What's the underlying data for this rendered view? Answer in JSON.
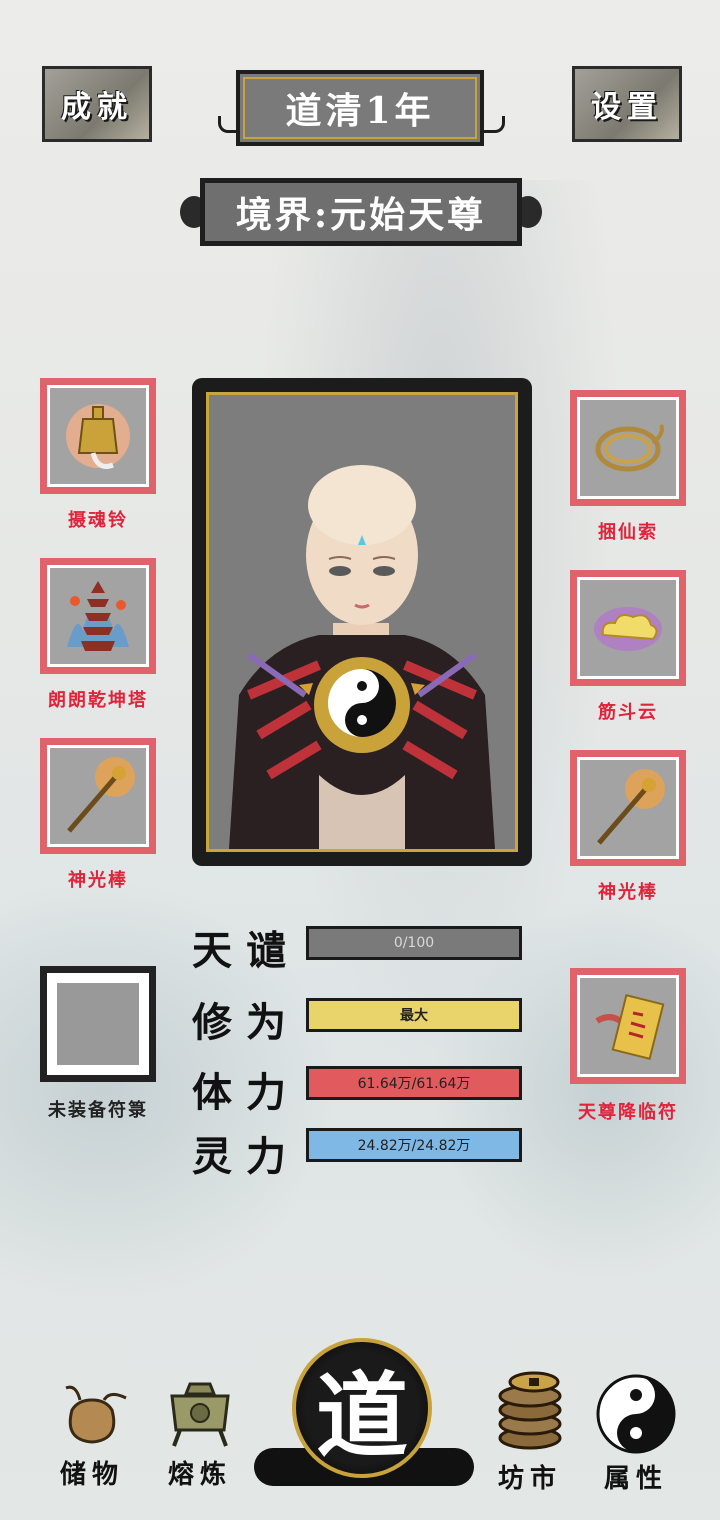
{
  "header": {
    "achievements_label": "成就",
    "settings_label": "设置",
    "year": "道清1年",
    "realm": "境界:元始天尊"
  },
  "equipment": {
    "left": [
      {
        "name": "摄魂铃"
      },
      {
        "name": "朗朗乾坤塔"
      },
      {
        "name": "神光棒"
      }
    ],
    "right": [
      {
        "name": "捆仙索"
      },
      {
        "name": "筋斗云"
      },
      {
        "name": "神光棒"
      }
    ],
    "talisman_empty": "未装备符箓",
    "talisman_right": "天尊降临符"
  },
  "stats": {
    "tribulation": {
      "label": "天谴",
      "value": "0/100",
      "fill": 0
    },
    "cultivation": {
      "label": "修为",
      "value": "最大",
      "fill": 1
    },
    "stamina": {
      "label": "体力",
      "value": "61.64万/61.64万",
      "fill": 1
    },
    "spirit": {
      "label": "灵力",
      "value": "24.82万/24.82万",
      "fill": 1
    }
  },
  "bottom_nav": {
    "storage": "储物",
    "refine": "熔炼",
    "dao": "道",
    "market": "坊市",
    "attributes": "属性"
  },
  "colors": {
    "slot_border": "#e0636b",
    "slot_label": "#e0243b",
    "cultivation_bar": "#e8d46a",
    "stamina_bar": "#e05a5e",
    "spirit_bar": "#7fb8e4",
    "tribulation_bar": "#7a7a7a",
    "gold": "#c8a23a"
  }
}
